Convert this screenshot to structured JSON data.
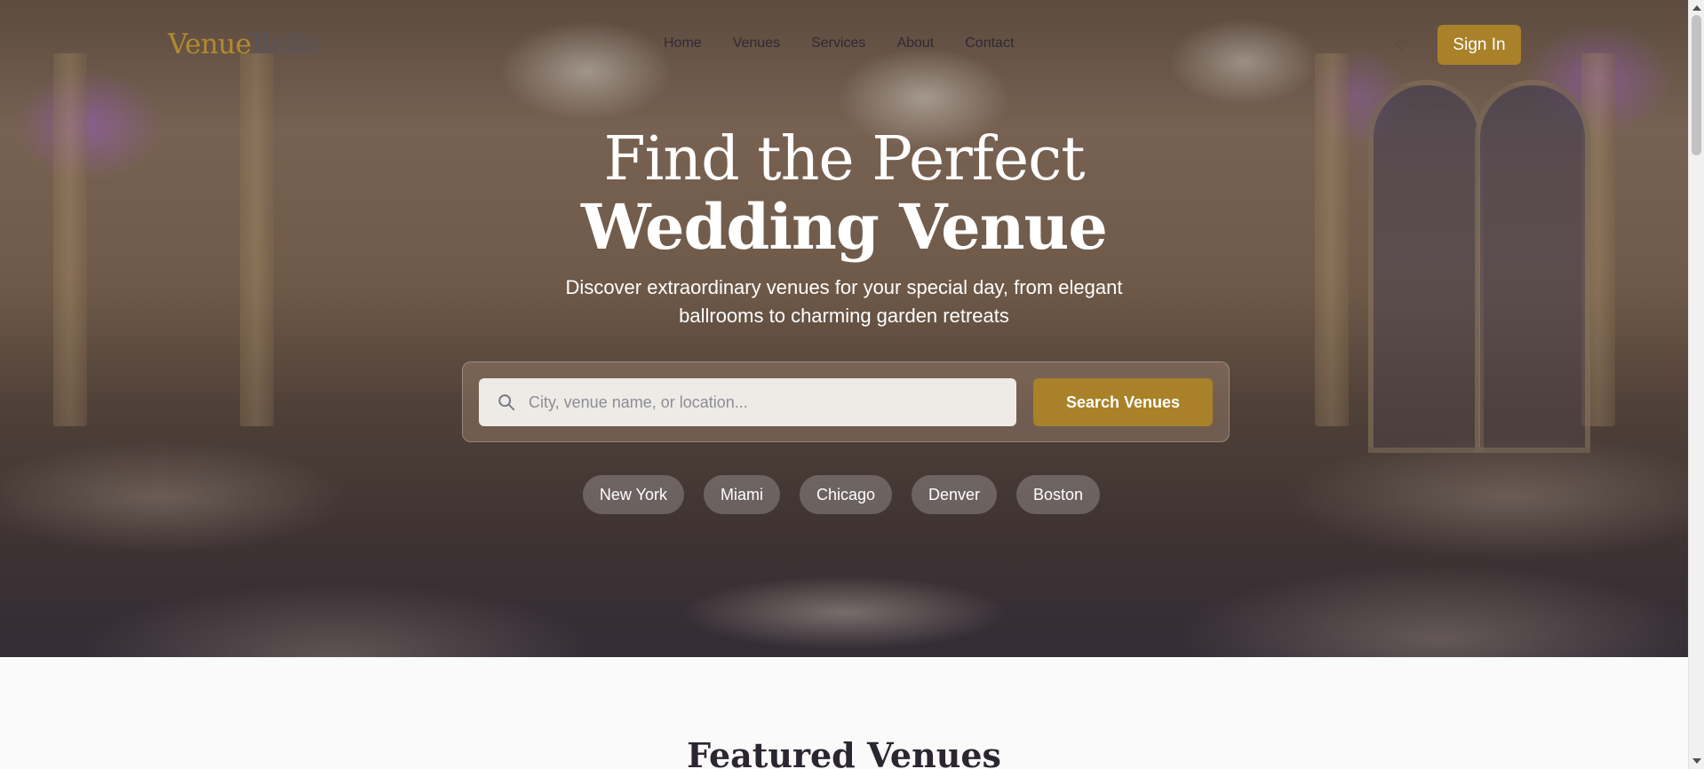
{
  "brand": {
    "part1": "Venue",
    "part2": "Belle"
  },
  "nav": {
    "items": [
      "Home",
      "Venues",
      "Services",
      "About",
      "Contact"
    ],
    "signin_label": "Sign In",
    "favorites_icon": "heart-icon"
  },
  "hero": {
    "title_line1": "Find the Perfect",
    "title_line2": "Wedding Venue",
    "subtitle": "Discover extraordinary venues for your special day, from elegant ballrooms to charming garden retreats"
  },
  "search": {
    "placeholder": "City, venue name, or location...",
    "value": "",
    "button_label": "Search Venues",
    "icon": "search-icon"
  },
  "cities": [
    "New York",
    "Miami",
    "Chicago",
    "Denver",
    "Boston"
  ],
  "featured": {
    "title": "Featured Venues"
  },
  "colors": {
    "accent": "#a98128",
    "brand_gold": "#b38a2e",
    "text_dark": "#2f2a33"
  }
}
